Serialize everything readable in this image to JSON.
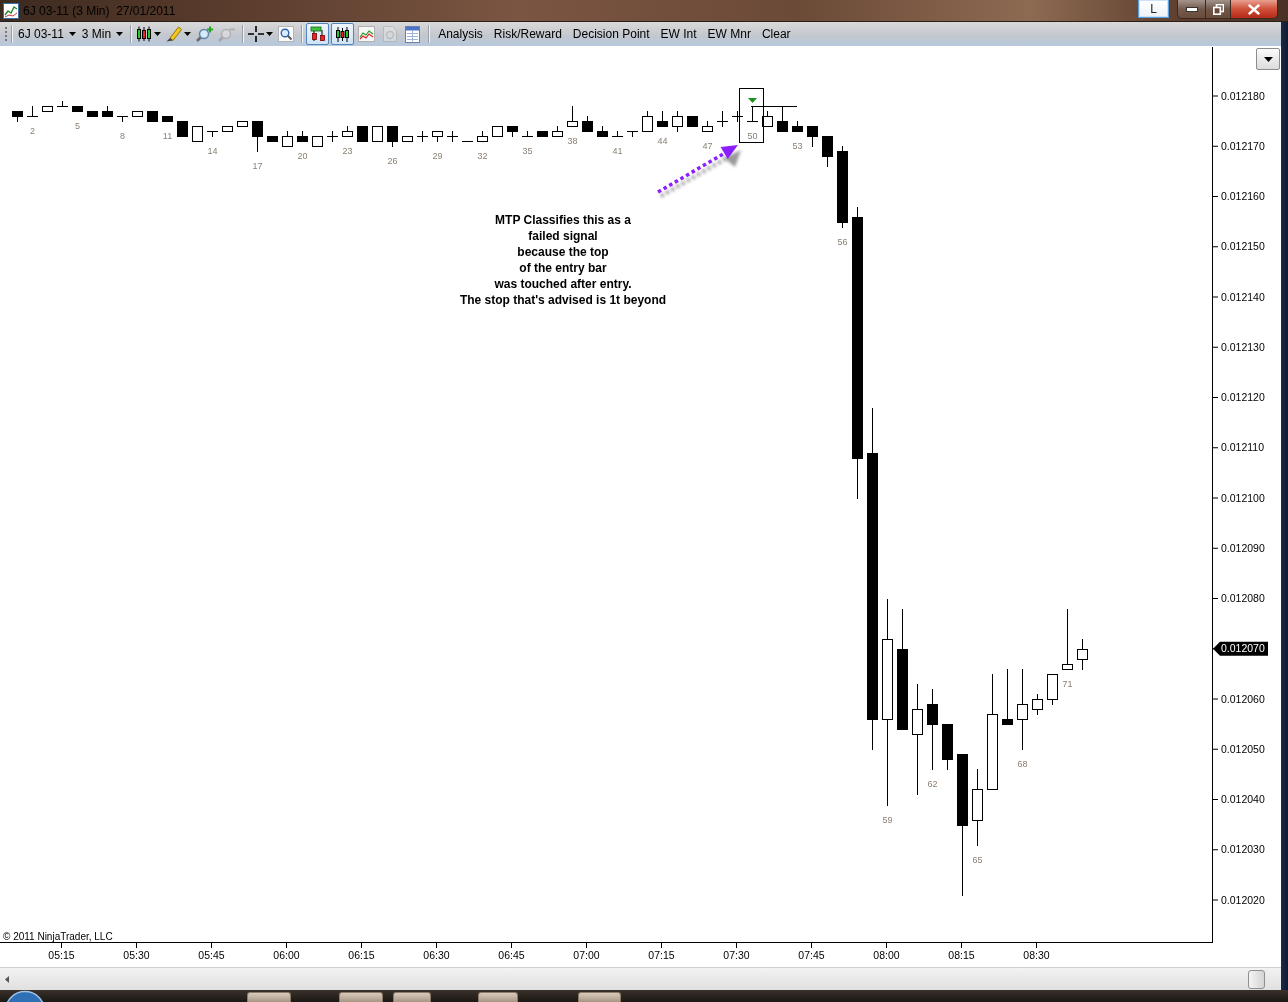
{
  "window": {
    "title": "6J 03-11 (3 Min)  27/01/2011",
    "language_indicator": "L"
  },
  "toolbar": {
    "instrument": "6J 03-11",
    "interval": "3 Min",
    "tool_groups": [
      {
        "tools": [
          {
            "kind": "chart-style",
            "dropdown": true,
            "disabled": false
          },
          {
            "kind": "draw",
            "dropdown": true,
            "disabled": false
          },
          {
            "kind": "zoom-in",
            "dropdown": false,
            "disabled": false
          },
          {
            "kind": "zoom-out",
            "dropdown": false,
            "disabled": true
          }
        ]
      },
      {
        "tools": [
          {
            "kind": "crosshair",
            "dropdown": true,
            "disabled": false
          },
          {
            "kind": "magnifier",
            "dropdown": false,
            "disabled": false
          }
        ]
      }
    ],
    "views": [
      {
        "kind": "bars",
        "selected": true,
        "disabled": false
      },
      {
        "kind": "candles",
        "selected": true,
        "disabled": false
      },
      {
        "kind": "line",
        "selected": false,
        "disabled": false
      },
      {
        "kind": "document",
        "selected": false,
        "disabled": true
      },
      {
        "kind": "table",
        "selected": false,
        "disabled": false
      }
    ],
    "commands": [
      "Analysis",
      "Risk/Reward",
      "Decision Point",
      "EW Int",
      "EW Mnr",
      "Clear"
    ]
  },
  "chart": {
    "bar_numbers": [
      "2",
      "5",
      "8",
      "11",
      "14",
      "17",
      "20",
      "23",
      "26",
      "29",
      "32",
      "35",
      "38",
      "41",
      "44",
      "47",
      "50",
      "53",
      "56",
      "59",
      "62",
      "65",
      "68",
      "71"
    ],
    "annotation": "MTP Classifies this as a\nfailed signal\nbecause the top\nof the entry bar\nwas touched after entry.\nThe stop that's advised is 1t beyond",
    "copyright": "© 2011 NinjaTrader, LLC",
    "price_axis": [
      {
        "label": "0.012180",
        "kind": "tick"
      },
      {
        "label": "0.012170",
        "kind": "tick"
      },
      {
        "label": "0.012160",
        "kind": "tick"
      },
      {
        "label": "0.012150",
        "kind": "tick"
      },
      {
        "label": "0.012140",
        "kind": "tick"
      },
      {
        "label": "0.012130",
        "kind": "tick"
      },
      {
        "label": "0.012120",
        "kind": "tick"
      },
      {
        "label": "0.012110",
        "kind": "tick"
      },
      {
        "label": "0.012100",
        "kind": "tick"
      },
      {
        "label": "0.012090",
        "kind": "tick"
      },
      {
        "label": "0.012080",
        "kind": "tick"
      },
      {
        "label": "0.012070",
        "kind": "last-price"
      },
      {
        "label": "0.012060",
        "kind": "tick"
      },
      {
        "label": "0.012050",
        "kind": "tick"
      },
      {
        "label": "0.012040",
        "kind": "tick"
      },
      {
        "label": "0.012030",
        "kind": "tick"
      },
      {
        "label": "0.012020",
        "kind": "tick"
      }
    ],
    "time_axis": [
      "05:15",
      "05:30",
      "05:45",
      "06:00",
      "06:15",
      "06:30",
      "06:45",
      "07:00",
      "07:15",
      "07:30",
      "07:45",
      "08:00",
      "08:15",
      "08:30"
    ]
  }
}
